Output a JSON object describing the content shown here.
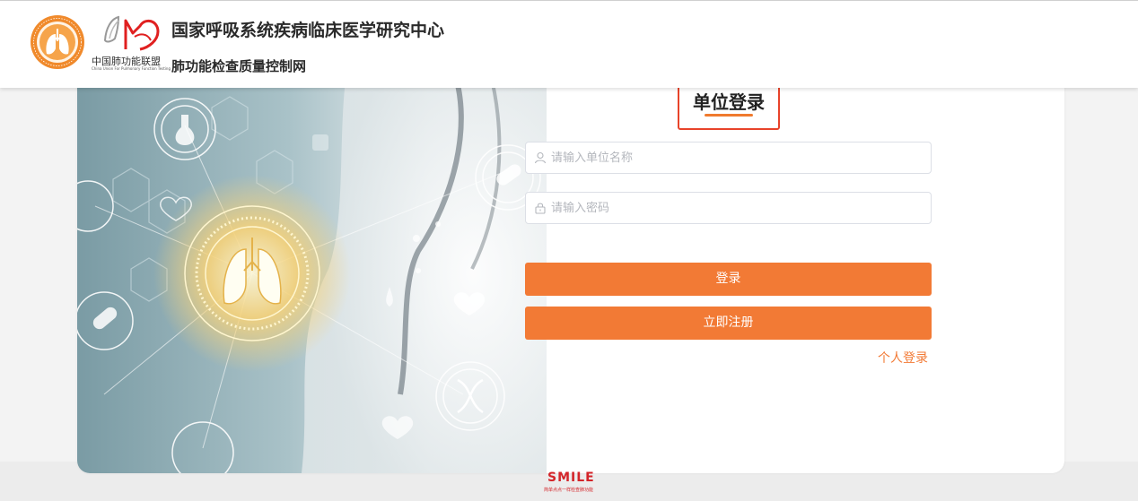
{
  "header": {
    "center_title": "国家呼吸系统疾病临床医学研究中心",
    "site_subtitle": "肺功能检查质量控制网",
    "union_cn": "中国肺功能联盟",
    "union_en": "China Union For Pulmonary Function Testing"
  },
  "login": {
    "title": "单位登录",
    "username_placeholder": "请输入单位名称",
    "password_placeholder": "请输入密码",
    "login_button": "登录",
    "register_button": "立即注册",
    "personal_login_link": "个人登录"
  },
  "footer": {
    "brand": "SMILE",
    "tagline": "简单点点一样检查肺功能"
  },
  "colors": {
    "accent": "#f27a35",
    "highlight_border": "#e8432a",
    "brand_red": "#d4252a"
  },
  "icons": [
    "user-icon",
    "lock-icon",
    "lung-icon",
    "heart-icon",
    "flask-icon",
    "dna-icon",
    "pill-icon"
  ]
}
